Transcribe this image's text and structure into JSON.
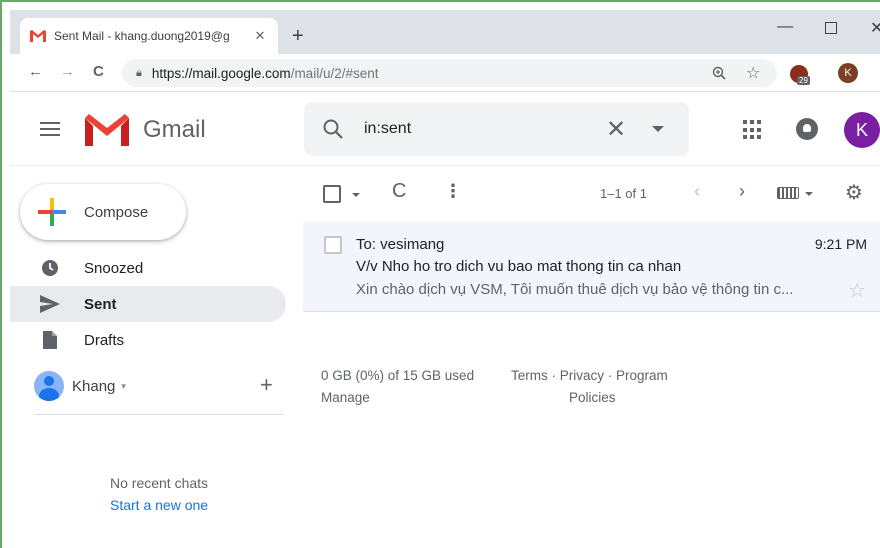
{
  "browser": {
    "tab_title": "Sent Mail - khang.duong2019@g",
    "tab_close": "✕",
    "new_tab": "+",
    "window_controls": {
      "minimize": "—",
      "close": "✕"
    },
    "nav": {
      "back": "←",
      "forward": "→",
      "reload": "C"
    },
    "url_host": "https://mail.google.com",
    "url_path": "/mail/u/2/#sent",
    "extension_count": "29",
    "profile_initial": "K",
    "menu": "⋮"
  },
  "gmail": {
    "logo_text": "Gmail",
    "search_value": "in:sent",
    "search_clear": "✕",
    "account_initial": "K"
  },
  "sidebar": {
    "compose_label": "Compose",
    "items": [
      {
        "label": "Snoozed",
        "icon": "clock-icon"
      },
      {
        "label": "Sent",
        "icon": "send-icon",
        "active": true
      },
      {
        "label": "Drafts",
        "icon": "draft-icon"
      }
    ],
    "hangouts": {
      "user_name": "Khang",
      "caret": "▾",
      "add": "+",
      "no_chats": "No recent chats",
      "start_new": "Start a new one"
    }
  },
  "toolbar": {
    "refresh": "C",
    "more": "⋮",
    "pager": "1–1 of 1",
    "prev": "‹",
    "next": "›",
    "settings": "⚙"
  },
  "emails": [
    {
      "to": "To: vesimang",
      "time": "9:21 PM",
      "subject": "V/v Nho ho tro dich vu bao mat thong tin ca nhan",
      "snippet": "Xin chào dịch vụ VSM, Tôi muốn thuê dịch vụ bảo vệ thông tin c...",
      "star": "☆"
    }
  ],
  "footer": {
    "storage": "0 GB (0%) of 15 GB used",
    "manage": "Manage",
    "terms": "Terms · Privacy · Program",
    "policies": "Policies"
  },
  "colors": {
    "gmail_red": "#ea4335",
    "account_purple": "#7b1fa2",
    "link_blue": "#1a73e8",
    "selected_row": "#f2f6fc",
    "active_nav": "#e8eaed"
  }
}
